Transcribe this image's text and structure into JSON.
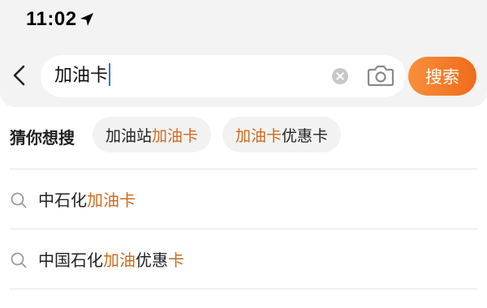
{
  "status_bar": {
    "time": "11:02",
    "icons": [
      "location-arrow-icon"
    ]
  },
  "search": {
    "back_icon": "chevron-left-icon",
    "query": "加油卡",
    "clear_icon": "clear-circle-icon",
    "camera_icon": "camera-icon",
    "button_label": "搜索"
  },
  "guess": {
    "label": "猜你想搜",
    "chips": [
      {
        "parts": [
          {
            "text": "加油站",
            "highlight": false
          },
          {
            "text": "加油卡",
            "highlight": true
          }
        ]
      },
      {
        "parts": [
          {
            "text": "加油卡",
            "highlight": true
          },
          {
            "text": "优惠卡",
            "highlight": false
          }
        ]
      }
    ]
  },
  "suggestions": [
    {
      "parts": [
        {
          "text": "中石化",
          "highlight": false
        },
        {
          "text": "加油卡",
          "highlight": true
        }
      ]
    },
    {
      "parts": [
        {
          "text": "中国石化",
          "highlight": false
        },
        {
          "text": "加油",
          "highlight": true
        },
        {
          "text": "优惠",
          "highlight": false
        },
        {
          "text": "卡",
          "highlight": true
        }
      ]
    }
  ],
  "colors": {
    "accent": "#f07a26",
    "highlight_text": "#d26a1c",
    "header_bg": "#f3f3f3"
  }
}
